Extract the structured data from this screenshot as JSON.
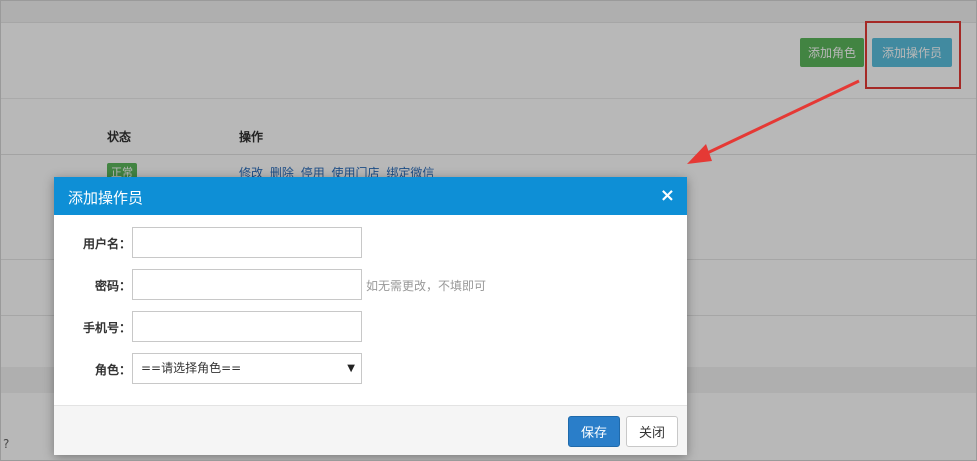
{
  "toolbar": {
    "add_role_label": "添加角色",
    "add_operator_label": "添加操作员"
  },
  "table": {
    "headers": {
      "status": "状态",
      "action": "操作"
    },
    "row1": {
      "status_badge": "正常",
      "actions": [
        "修改",
        "删除",
        "停用",
        "使用门店",
        "绑定微信"
      ]
    }
  },
  "bottom_fragment": "?",
  "modal": {
    "title": "添加操作员",
    "close_icon": "×",
    "fields": {
      "username": {
        "label": "用户名：",
        "value": ""
      },
      "password": {
        "label": "密码：",
        "value": "",
        "hint": "如无需更改，不填即可"
      },
      "phone": {
        "label": "手机号：",
        "value": ""
      },
      "role": {
        "label": "角色：",
        "selected": "==请选择角色=="
      }
    },
    "save_label": "保存",
    "close_label": "关闭"
  },
  "colors": {
    "header_blue": "#0e8fd6",
    "save_blue": "#2a7ec9",
    "green": "#5cb85c",
    "cyan": "#5bc0de",
    "highlight_red": "#e53935"
  }
}
